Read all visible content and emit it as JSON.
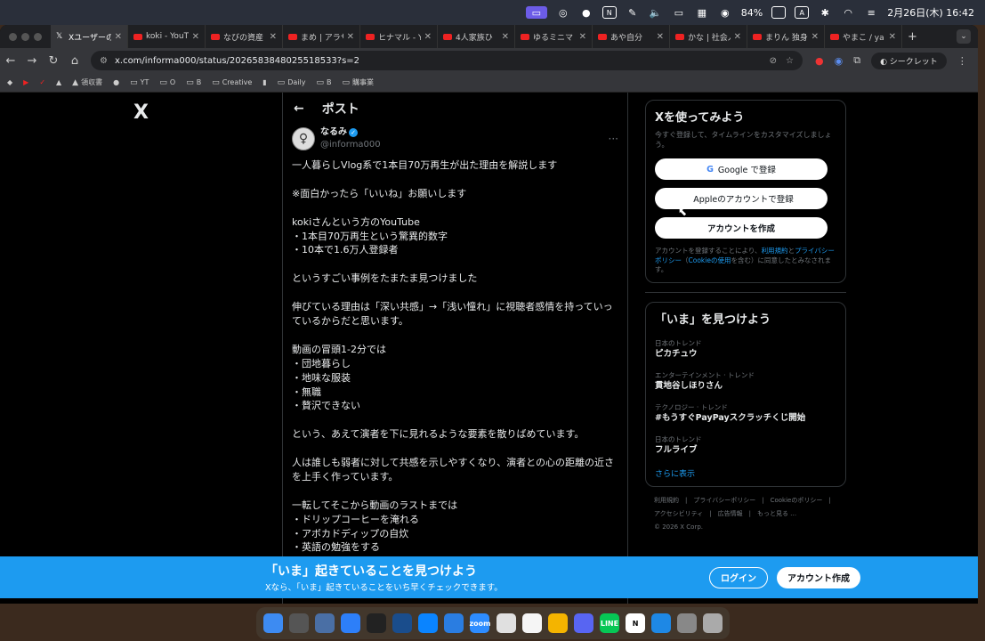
{
  "menubar": {
    "battery": "84%",
    "input_mode": "A",
    "datetime": "2月26日(木) 16:42"
  },
  "tabs": [
    {
      "label": "Xユーザーの",
      "icon": "x-icon",
      "active": true
    },
    {
      "label": "koki - YouT",
      "icon": "youtube-icon"
    },
    {
      "label": "なびの資産",
      "icon": "youtube-icon"
    },
    {
      "label": "まめ | アラサ",
      "icon": "youtube-icon"
    },
    {
      "label": "ヒナマル - Y",
      "icon": "youtube-icon"
    },
    {
      "label": "4人家族ひ",
      "icon": "youtube-icon"
    },
    {
      "label": "ゆるミニマ",
      "icon": "youtube-icon"
    },
    {
      "label": "あや自分",
      "icon": "youtube-icon"
    },
    {
      "label": "かな | 社会人",
      "icon": "youtube-icon"
    },
    {
      "label": "まりん 独身",
      "icon": "youtube-icon"
    },
    {
      "label": "やまこ / ya",
      "icon": "youtube-icon"
    }
  ],
  "toolbar": {
    "url": "x.com/informa000/status/2026583848025518533?s=2",
    "incognito_label": "シークレット"
  },
  "bookmarks": [
    "領収書",
    "YT",
    "O",
    "B",
    "Creative",
    "Daily",
    "B",
    "購事業"
  ],
  "x": {
    "logo": "X",
    "header_title": "ポスト",
    "author_name": "なるみ",
    "author_handle": "@informa000",
    "post_text": "一人暮らしVlog系で1本目70万再生が出た理由を解説します\n\n※面白かったら「いいね」お願いします\n\nkokiさんという方のYouTube\n・1本目70万再生という驚異的数字\n・10本で1.6万人登録者\n\nというすごい事例をたまたま見つけました\n\n伸びている理由は「深い共感」→「浅い憧れ」に視聴者感情を持っていっているからだと思います。\n\n動画の冒頭1-2分では\n・団地暮らし\n・地味な服装\n・無職\n・贅沢できない\n\nという、あえて演者を下に見れるような要素を散りばめています。\n\n人は誰しも弱者に対して共感を示しやすくなり、演者との心の距離の近さを上手く作っています。\n\n一転してそこから動画のラストまでは\n・ドリップコーヒーを淹れる\n・アボカドディップの自炊\n・英語の勉強をする"
  },
  "signup": {
    "title": "Xを使ってみよう",
    "subtitle": "今すぐ登録して、タイムラインをカスタマイズしましょう。",
    "google_label": "Google で登録",
    "apple_label": "Appleのアカウントで登録",
    "create_label": "アカウントを作成",
    "terms_prefix": "アカウントを登録することにより、",
    "terms_link": "利用規約",
    "terms_and": "と",
    "privacy_link": "プライバシーポリシー",
    "cookie_prefix": "（",
    "cookie_link": "Cookieの使用",
    "terms_suffix": "を含む）に同意したとみなされます。"
  },
  "trends": {
    "title": "「いま」を見つけよう",
    "items": [
      {
        "category": "日本のトレンド",
        "topic": "ピカチュウ"
      },
      {
        "category": "エンターテインメント · トレンド",
        "topic": "貫地谷しほりさん"
      },
      {
        "category": "テクノロジー · トレンド",
        "topic": "#もうすぐPayPayスクラッチくじ開始"
      },
      {
        "category": "日本のトレンド",
        "topic": "フルライブ"
      }
    ],
    "show_more": "さらに表示"
  },
  "footer": {
    "line1": "利用規約　|　プライバシーポリシー　|　Cookieのポリシー　|",
    "line2": "アクセシビリティ　|　広告情報　|　もっと見る …",
    "line3": "© 2026 X Corp."
  },
  "banner": {
    "title": "「いま」起きていることを見つけよう",
    "subtitle": "Xなら、「いま」起きていることをいち早くチェックできます。",
    "login_label": "ログイン",
    "signup_label": "アカウント作成"
  },
  "dock": [
    {
      "name": "finder",
      "color": "#3d8bf2"
    },
    {
      "name": "app-2",
      "color": "#555"
    },
    {
      "name": "app-3",
      "color": "#4a6fa5"
    },
    {
      "name": "app-4",
      "color": "#2d7ff9"
    },
    {
      "name": "app-5",
      "color": "#222"
    },
    {
      "name": "app-6",
      "color": "#1a4d8c"
    },
    {
      "name": "app-7",
      "color": "#0a84ff"
    },
    {
      "name": "app-8",
      "color": "#2a7de1"
    },
    {
      "name": "zoom",
      "label": "zoom",
      "color": "#2d8cff"
    },
    {
      "name": "chrome",
      "color": "#e0e0e0"
    },
    {
      "name": "app-11",
      "color": "#f5f5f5"
    },
    {
      "name": "app-12",
      "color": "#f4b400"
    },
    {
      "name": "discord",
      "color": "#5865f2"
    },
    {
      "name": "line",
      "label": "LINE",
      "color": "#06c755"
    },
    {
      "name": "notion",
      "label": "N",
      "color": "#fff"
    },
    {
      "name": "app-16",
      "color": "#1e88e5"
    },
    {
      "name": "settings",
      "color": "#888"
    },
    {
      "name": "trash",
      "color": "#aaa"
    }
  ]
}
